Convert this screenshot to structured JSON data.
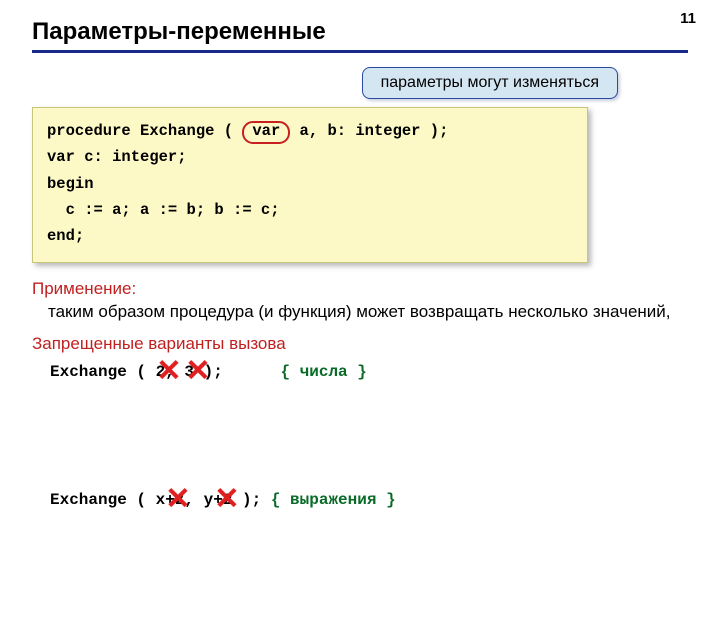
{
  "page_number": "11",
  "title": "Параметры-переменные",
  "callout": "параметры могут изменяться",
  "code": {
    "l1a": "procedure Exchange ( ",
    "l1_var": "var",
    "l1b": " a, b: integer );",
    "l2": "var c: integer;",
    "l3": "begin",
    "l4": "  c := a; a := b; b := c;",
    "l5": "end;"
  },
  "usage_label": "Применение:",
  "usage_text": "таким образом процедура (и функция) может возвращать несколько значений,",
  "forbidden_label": "Запрещенные варианты вызова",
  "forbidden": {
    "row1_code": "Exchange ( 2, 3 );      ",
    "row1_comment": "{ числа }",
    "row2_code": "Exchange ( x+z, y+2 ); ",
    "row2_comment": "{ выражения }"
  },
  "cross_glyph": "✕"
}
